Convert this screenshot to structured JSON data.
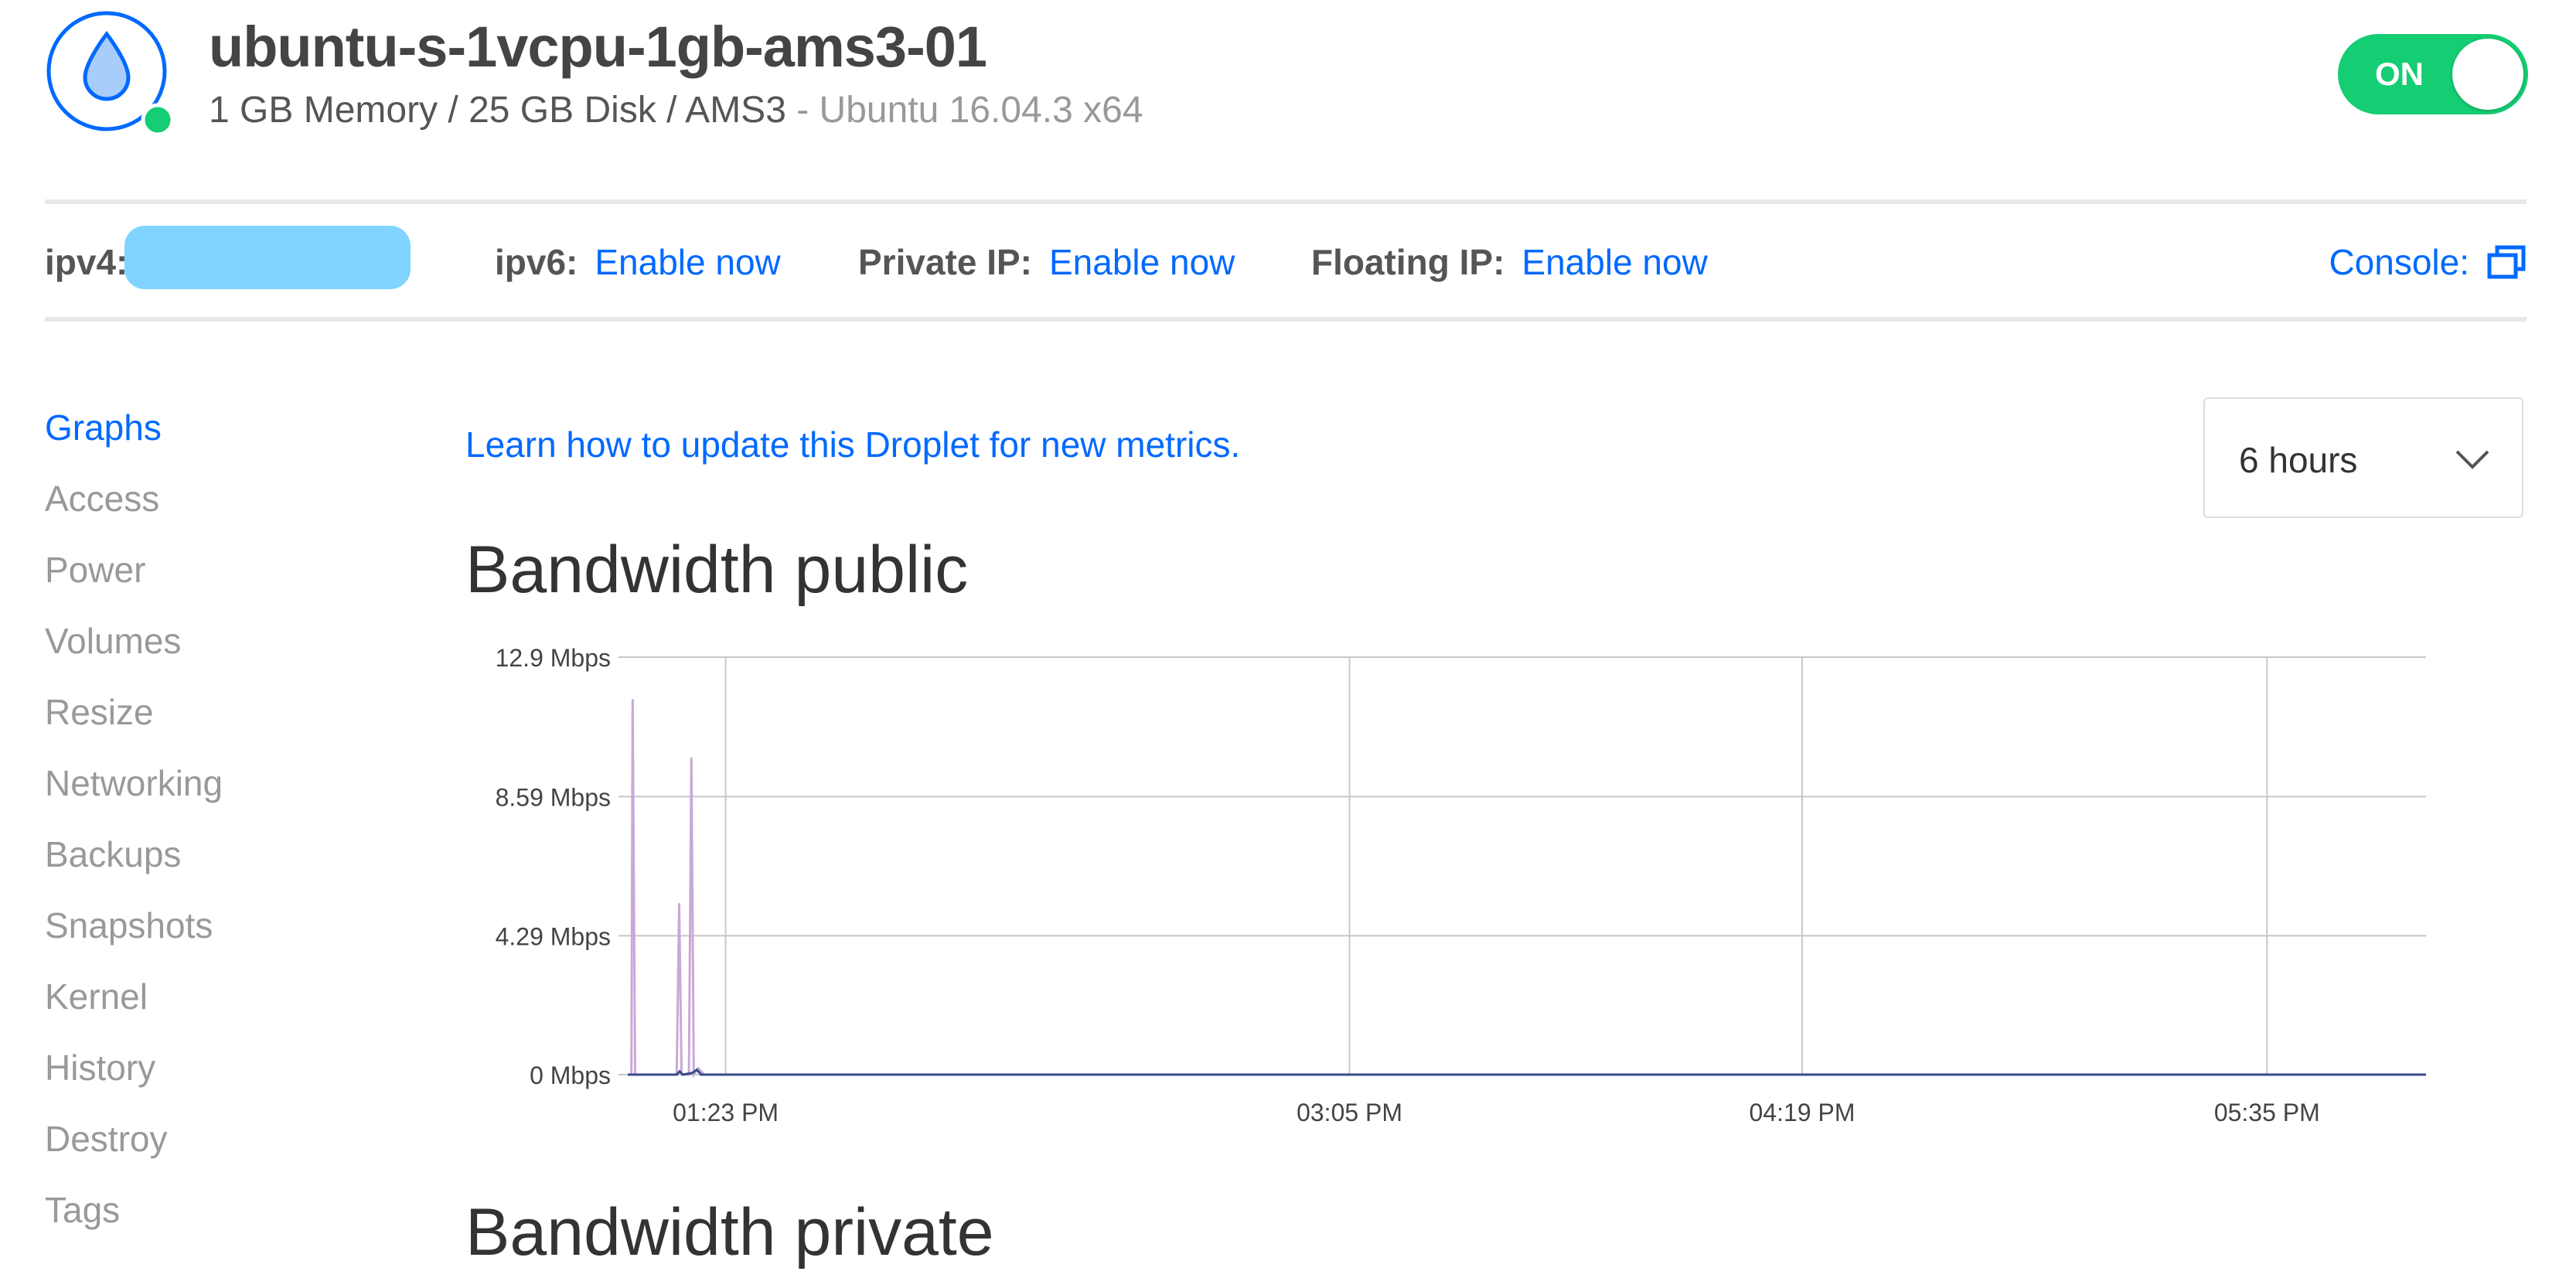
{
  "droplet": {
    "name": "ubuntu-s-1vcpu-1gb-ams3-01",
    "specs": "1 GB Memory / 25 GB Disk / AMS3",
    "os": " - Ubuntu 16.04.3 x64",
    "power_label": "ON",
    "status_color": "#15cd72"
  },
  "ip_bar": {
    "ipv4_label": "ipv4:",
    "ipv6_label": "ipv6:",
    "ipv6_link": "Enable now",
    "private_ip_label": "Private IP:",
    "private_ip_link": "Enable now",
    "floating_ip_label": "Floating IP:",
    "floating_ip_link": "Enable now",
    "console_label": "Console:"
  },
  "sidebar": {
    "items": [
      {
        "label": "Graphs",
        "active": true
      },
      {
        "label": "Access"
      },
      {
        "label": "Power"
      },
      {
        "label": "Volumes"
      },
      {
        "label": "Resize"
      },
      {
        "label": "Networking"
      },
      {
        "label": "Backups"
      },
      {
        "label": "Snapshots"
      },
      {
        "label": "Kernel"
      },
      {
        "label": "History"
      },
      {
        "label": "Destroy"
      },
      {
        "label": "Tags"
      }
    ]
  },
  "main": {
    "learn_link": "Learn how to update this Droplet for new metrics.",
    "time_range": "6 hours",
    "next_chart_title": "Bandwidth private"
  },
  "chart_data": {
    "type": "line",
    "title": "Bandwidth public",
    "y_tick_labels": [
      "0 Mbps",
      "4.29 Mbps",
      "8.59 Mbps",
      "12.9 Mbps"
    ],
    "y_ticks": [
      0,
      4.29,
      8.59,
      12.9
    ],
    "ylim": [
      0,
      12.9
    ],
    "x_tick_labels": [
      "01:23 PM",
      "03:05 PM",
      "04:19 PM",
      "05:35 PM"
    ],
    "x_ticks_min": [
      83,
      185,
      259,
      335
    ],
    "xlim_min": [
      67,
      361
    ],
    "grid": true,
    "series": [
      {
        "color": "#c9a8d8",
        "points": [
          [
            67.6,
            0
          ],
          [
            67.8,
            11.6
          ],
          [
            68.2,
            0
          ],
          [
            75,
            0
          ],
          [
            75.4,
            5.3
          ],
          [
            75.8,
            0
          ],
          [
            77,
            0
          ],
          [
            77.4,
            9.8
          ],
          [
            77.8,
            0
          ],
          [
            78.5,
            0.2
          ],
          [
            79.5,
            0
          ],
          [
            83,
            0
          ],
          [
            361,
            0
          ]
        ]
      },
      {
        "color": "#3a4a8a",
        "points": [
          [
            67,
            0
          ],
          [
            75,
            0
          ],
          [
            75.5,
            0.1
          ],
          [
            76,
            0
          ],
          [
            77.5,
            0.05
          ],
          [
            78.3,
            0.15
          ],
          [
            79,
            0
          ],
          [
            361,
            0
          ]
        ]
      }
    ]
  }
}
